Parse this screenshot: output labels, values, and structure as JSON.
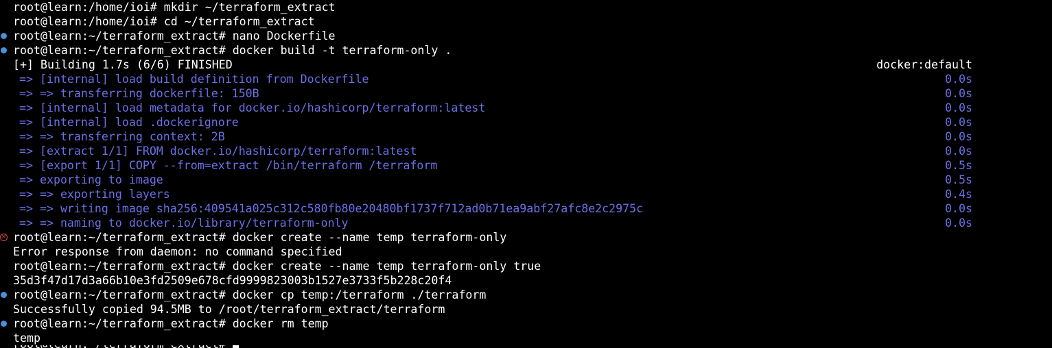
{
  "colors": {
    "background": "#000000",
    "text": "#ffffff",
    "build_step": "#6b70e6",
    "success_dot": "#4a90d9",
    "error_icon": "#e0494d"
  },
  "lines": [
    {
      "kind": "plain",
      "marker": "none",
      "text": "root@learn:/home/ioi# mkdir ~/terraform_extract"
    },
    {
      "kind": "plain",
      "marker": "none",
      "text": "root@learn:/home/ioi# cd ~/terraform_extract"
    },
    {
      "kind": "plain",
      "marker": "success-dot",
      "text": "root@learn:~/terraform_extract# nano Dockerfile"
    },
    {
      "kind": "plain",
      "marker": "success-dot",
      "text": "root@learn:~/terraform_extract# docker build -t terraform-only ."
    },
    {
      "kind": "plain",
      "marker": "none",
      "text": "[+] Building 1.7s (6/6) FINISHED",
      "right": "docker:default"
    },
    {
      "kind": "step",
      "marker": "none",
      "text": "=> [internal] load build definition from Dockerfile",
      "right": "0.0s"
    },
    {
      "kind": "step",
      "marker": "none",
      "text": "=> => transferring dockerfile: 150B",
      "right": "0.0s"
    },
    {
      "kind": "step",
      "marker": "none",
      "text": "=> [internal] load metadata for docker.io/hashicorp/terraform:latest",
      "right": "0.0s"
    },
    {
      "kind": "step",
      "marker": "none",
      "text": "=> [internal] load .dockerignore",
      "right": "0.0s"
    },
    {
      "kind": "step",
      "marker": "none",
      "text": "=> => transferring context: 2B",
      "right": "0.0s"
    },
    {
      "kind": "step",
      "marker": "none",
      "text": "=> [extract 1/1] FROM docker.io/hashicorp/terraform:latest",
      "right": "0.0s"
    },
    {
      "kind": "step",
      "marker": "none",
      "text": "=> [export 1/1] COPY --from=extract /bin/terraform /terraform",
      "right": "0.5s"
    },
    {
      "kind": "step",
      "marker": "none",
      "text": "=> exporting to image",
      "right": "0.5s"
    },
    {
      "kind": "step",
      "marker": "none",
      "text": "=> => exporting layers",
      "right": "0.4s"
    },
    {
      "kind": "step",
      "marker": "none",
      "text": "=> => writing image sha256:409541a025c312c580fb80e20480bf1737f712ad0b71ea9abf27afc8e2c2975c",
      "right": "0.0s"
    },
    {
      "kind": "step",
      "marker": "none",
      "text": "=> => naming to docker.io/library/terraform-only",
      "right": "0.0s"
    },
    {
      "kind": "plain",
      "marker": "error-icon",
      "text": "root@learn:~/terraform_extract# docker create --name temp terraform-only"
    },
    {
      "kind": "plain",
      "marker": "none",
      "text": "Error response from daemon: no command specified"
    },
    {
      "kind": "plain",
      "marker": "none",
      "text": "root@learn:~/terraform_extract# docker create --name temp terraform-only true"
    },
    {
      "kind": "plain",
      "marker": "none",
      "text": "35d3f47d17d3a66b10e3fd2509e678cfd9999823003b1527e3733f5b228c20f4"
    },
    {
      "kind": "plain",
      "marker": "success-dot",
      "text": "root@learn:~/terraform_extract# docker cp temp:/terraform ./terraform"
    },
    {
      "kind": "plain",
      "marker": "none",
      "text": "Successfully copied 94.5MB to /root/terraform_extract/terraform"
    },
    {
      "kind": "plain",
      "marker": "success-dot",
      "text": "root@learn:~/terraform_extract# docker rm temp"
    },
    {
      "kind": "plain",
      "marker": "none",
      "text": "temp"
    }
  ],
  "prompt": {
    "text": "root@learn:~/terraform_extract# ",
    "input": ""
  }
}
